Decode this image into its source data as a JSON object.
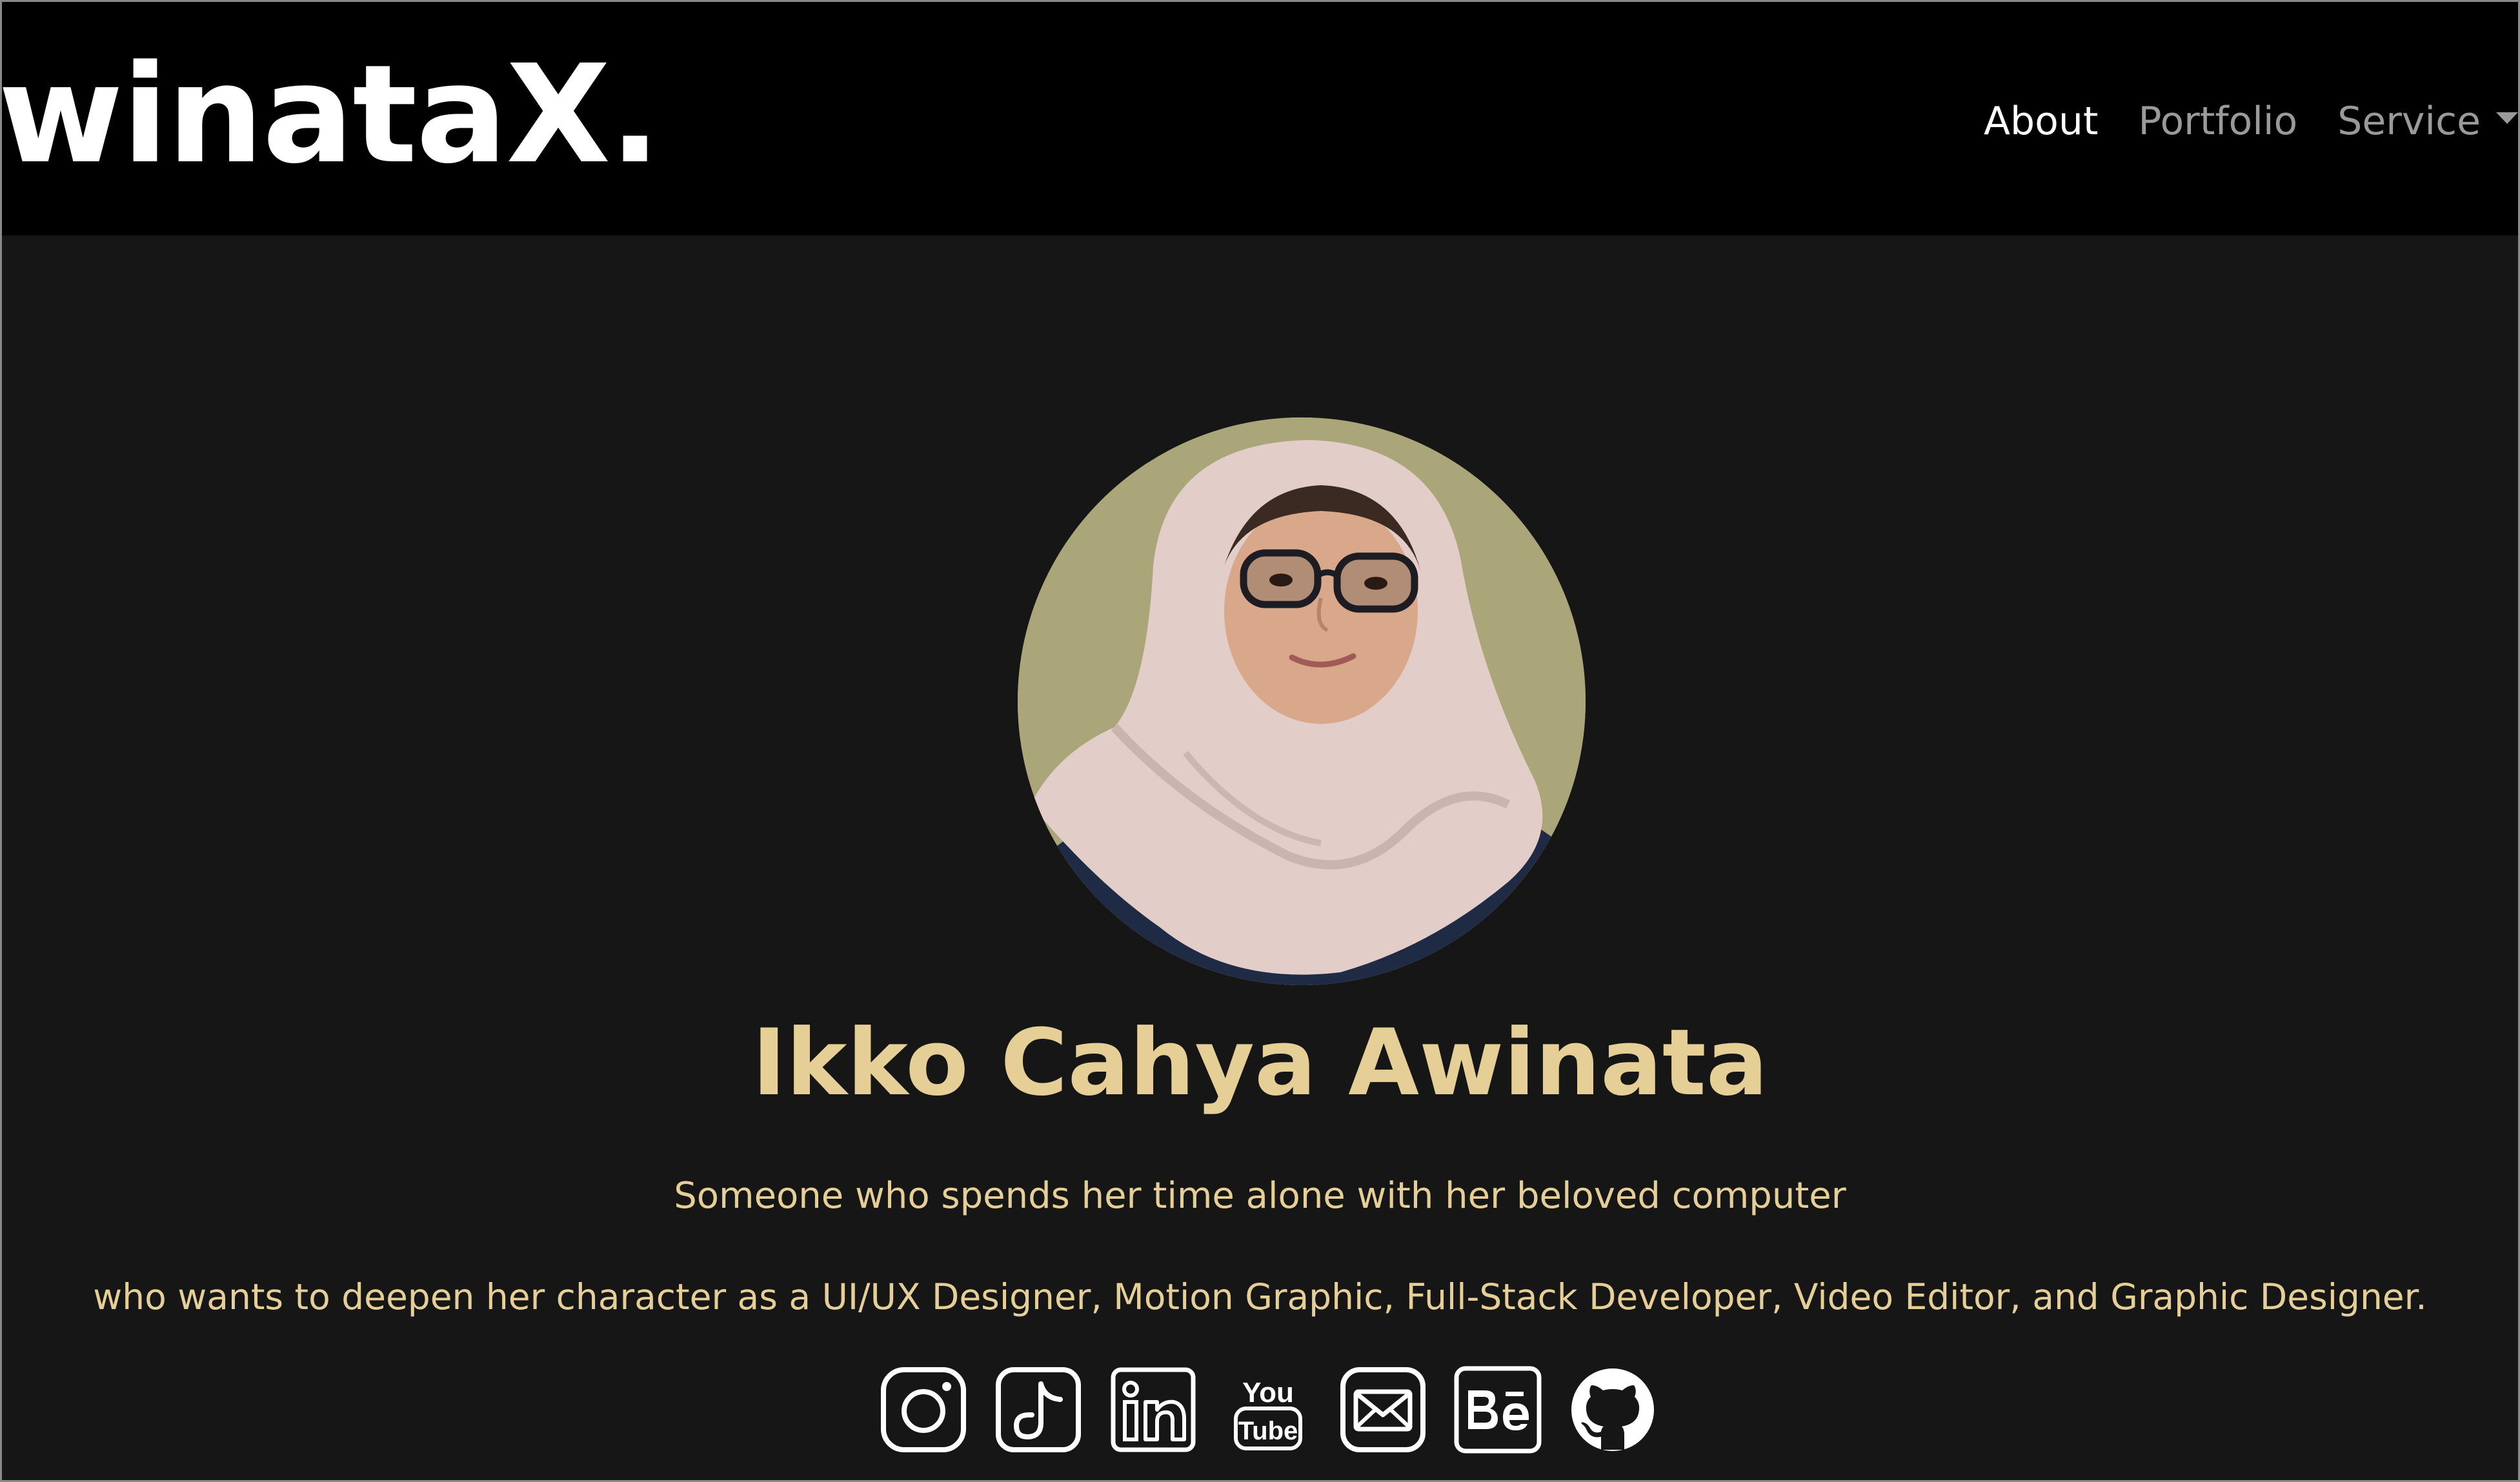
{
  "brand": "winataX.",
  "nav": {
    "about": "About",
    "portfolio": "Portfolio",
    "service": "Service"
  },
  "profile": {
    "name": "Ikko Cahya Awinata",
    "tagline_1": "Someone who spends her time alone with her beloved computer",
    "tagline_2": "who wants to deepen her character as a UI/UX Designer, Motion Graphic, Full-Stack Developer, Video Editor, and Graphic Designer."
  },
  "socials": [
    "instagram-icon",
    "tiktok-icon",
    "linkedin-icon",
    "youtube-icon",
    "email-icon",
    "behance-icon",
    "github-icon"
  ],
  "colors": {
    "navbar_bg": "#000000",
    "page_bg": "#161616",
    "accent": "#e6cf96",
    "avatar_bg": "#aaa67a",
    "nav_inactive": "#9a9a9a",
    "nav_active": "#ffffff"
  }
}
